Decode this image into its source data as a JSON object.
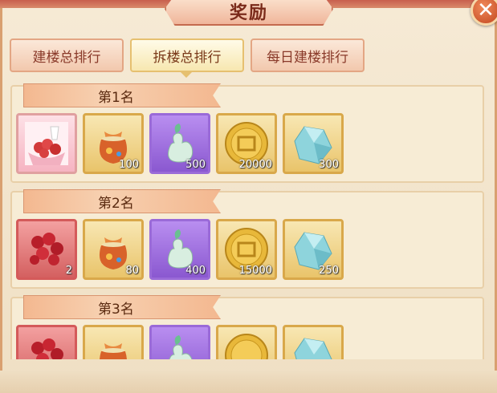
{
  "title": "奖励",
  "close_label": "✕",
  "tabs": [
    {
      "label": "建楼总排行",
      "active": false
    },
    {
      "label": "拆楼总排行",
      "active": true
    },
    {
      "label": "每日建楼排行",
      "active": false
    }
  ],
  "ranks": [
    {
      "label": "第1名",
      "items": [
        {
          "icon": "rose-bouquet-gift-icon",
          "quantity": ""
        },
        {
          "icon": "treasure-bag-icon",
          "quantity": "100"
        },
        {
          "icon": "jade-gourd-icon",
          "quantity": "500"
        },
        {
          "icon": "gold-coin-icon",
          "quantity": "20000"
        },
        {
          "icon": "crystal-gem-icon",
          "quantity": "300"
        }
      ]
    },
    {
      "label": "第2名",
      "items": [
        {
          "icon": "rose-bouquet-icon",
          "quantity": "2"
        },
        {
          "icon": "treasure-bag-icon",
          "quantity": "80"
        },
        {
          "icon": "jade-gourd-icon",
          "quantity": "400"
        },
        {
          "icon": "gold-coin-icon",
          "quantity": "15000"
        },
        {
          "icon": "crystal-gem-icon",
          "quantity": "250"
        }
      ]
    },
    {
      "label": "第3名",
      "items": [
        {
          "icon": "rose-bouquet-icon",
          "quantity": ""
        },
        {
          "icon": "treasure-bag-icon",
          "quantity": ""
        },
        {
          "icon": "jade-gourd-icon",
          "quantity": ""
        },
        {
          "icon": "gold-coin-icon",
          "quantity": ""
        },
        {
          "icon": "crystal-gem-icon",
          "quantity": ""
        }
      ]
    }
  ]
}
